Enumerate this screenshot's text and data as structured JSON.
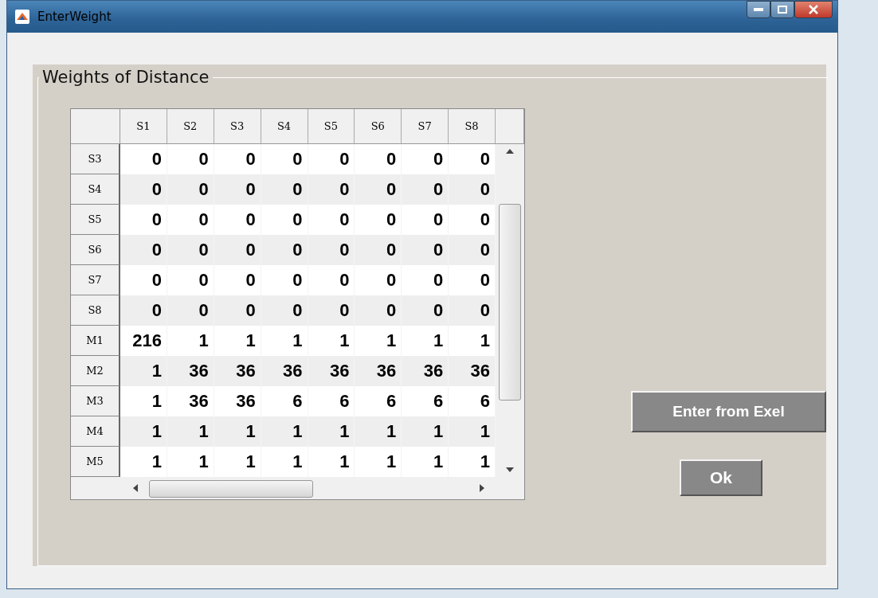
{
  "window": {
    "title": "EnterWeight"
  },
  "panel": {
    "title": "Weights of Distance"
  },
  "table": {
    "columns": [
      "S1",
      "S2",
      "S3",
      "S4",
      "S5",
      "S6",
      "S7",
      "S8"
    ],
    "rows": [
      {
        "header": "S3",
        "cells": [
          "0",
          "0",
          "0",
          "0",
          "0",
          "0",
          "0",
          "0"
        ]
      },
      {
        "header": "S4",
        "cells": [
          "0",
          "0",
          "0",
          "0",
          "0",
          "0",
          "0",
          "0"
        ]
      },
      {
        "header": "S5",
        "cells": [
          "0",
          "0",
          "0",
          "0",
          "0",
          "0",
          "0",
          "0"
        ]
      },
      {
        "header": "S6",
        "cells": [
          "0",
          "0",
          "0",
          "0",
          "0",
          "0",
          "0",
          "0"
        ]
      },
      {
        "header": "S7",
        "cells": [
          "0",
          "0",
          "0",
          "0",
          "0",
          "0",
          "0",
          "0"
        ]
      },
      {
        "header": "S8",
        "cells": [
          "0",
          "0",
          "0",
          "0",
          "0",
          "0",
          "0",
          "0"
        ]
      },
      {
        "header": "M1",
        "cells": [
          "216",
          "1",
          "1",
          "1",
          "1",
          "1",
          "1",
          "1"
        ]
      },
      {
        "header": "M2",
        "cells": [
          "1",
          "36",
          "36",
          "36",
          "36",
          "36",
          "36",
          "36"
        ]
      },
      {
        "header": "M3",
        "cells": [
          "1",
          "36",
          "36",
          "6",
          "6",
          "6",
          "6",
          "6"
        ]
      },
      {
        "header": "M4",
        "cells": [
          "1",
          "1",
          "1",
          "1",
          "1",
          "1",
          "1",
          "1"
        ]
      },
      {
        "header": "M5",
        "cells": [
          "1",
          "1",
          "1",
          "1",
          "1",
          "1",
          "1",
          "1"
        ]
      }
    ]
  },
  "buttons": [
    {
      "label": "Enter from Exel",
      "kind": "wide"
    },
    {
      "label": "Ok",
      "kind": "small"
    }
  ]
}
